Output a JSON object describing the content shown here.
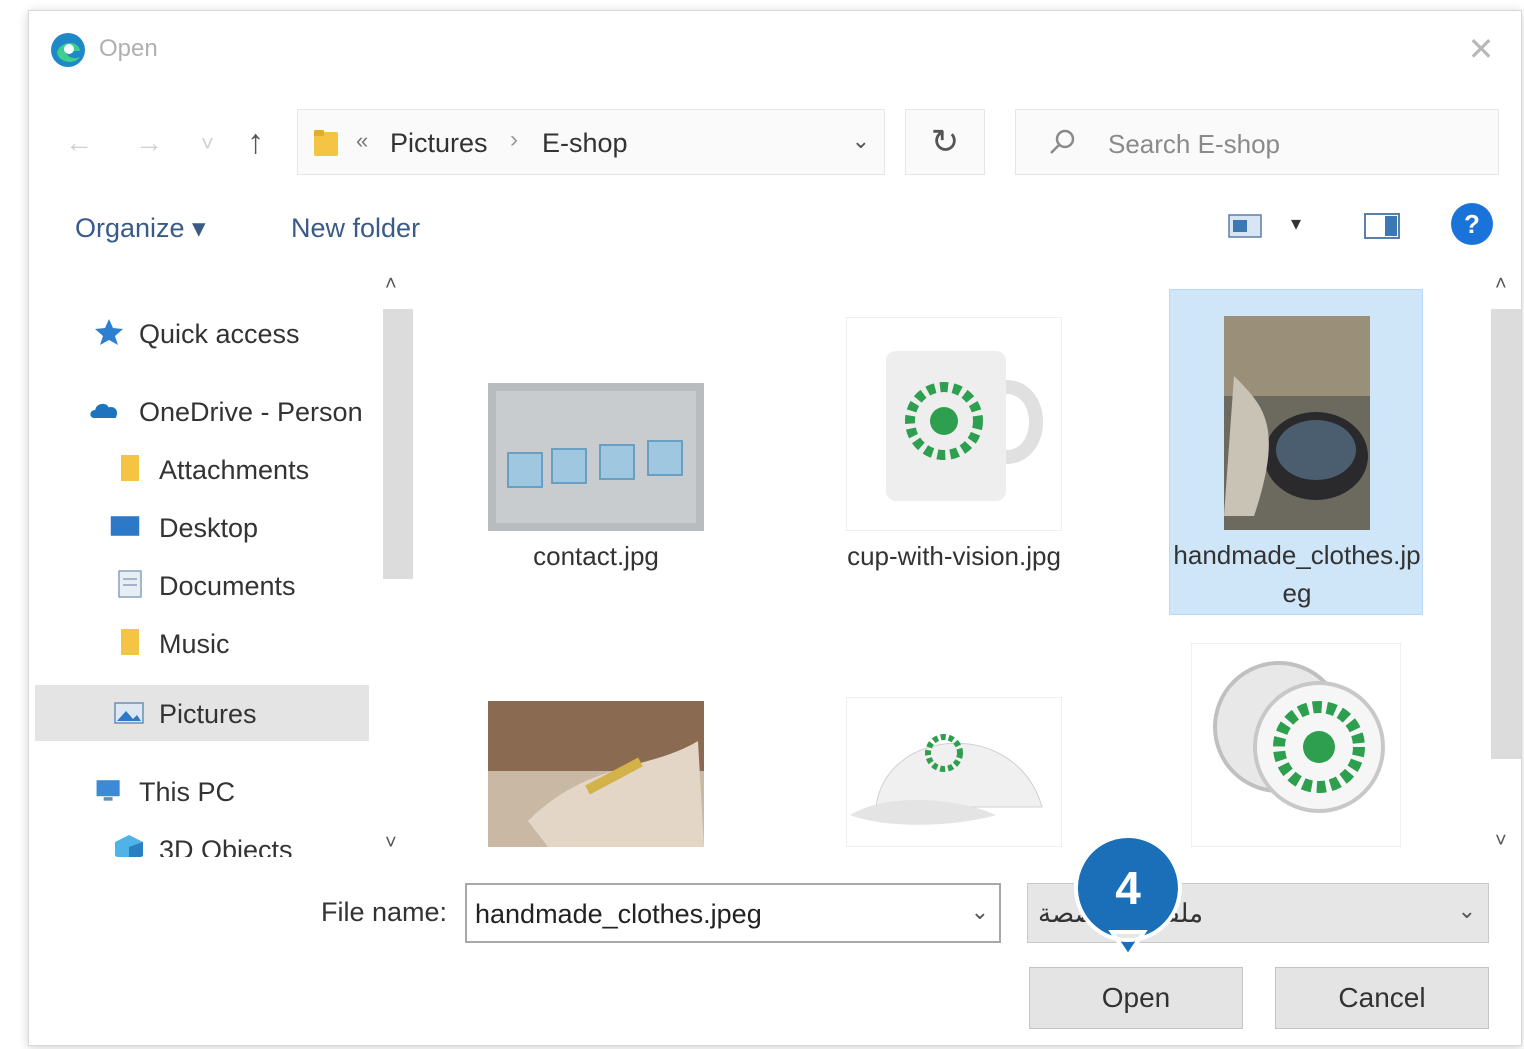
{
  "window": {
    "title": "Open",
    "close_glyph": "✕"
  },
  "nav": {
    "back_glyph": "←",
    "forward_glyph": "→",
    "up_glyph": "↑",
    "recent_glyph": "˅",
    "path_prefix_glyph": "«",
    "breadcrumb": [
      "Pictures",
      "E-shop"
    ],
    "breadcrumb_sep": "›",
    "dropdown_glyph": "⌄",
    "refresh_glyph": "↻",
    "search_placeholder": "Search E-shop"
  },
  "toolbar": {
    "organize_label": "Organize ▾",
    "new_folder_label": "New folder",
    "view_dropdown_glyph": "▾",
    "help_glyph": "?"
  },
  "sidebar": {
    "items": [
      {
        "label": "Quick access",
        "icon": "star-icon"
      },
      {
        "label": "OneDrive - Person",
        "icon": "cloud-icon"
      },
      {
        "label": "Attachments",
        "icon": "folder-icon"
      },
      {
        "label": "Desktop",
        "icon": "desktop-icon"
      },
      {
        "label": "Documents",
        "icon": "documents-icon"
      },
      {
        "label": "Music",
        "icon": "music-folder-icon"
      },
      {
        "label": "Pictures",
        "icon": "pictures-icon",
        "selected": true
      },
      {
        "label": "This PC",
        "icon": "computer-icon"
      },
      {
        "label": "3D Objects",
        "icon": "cube-icon"
      }
    ],
    "scroll_up": "˄",
    "scroll_down": "˅"
  },
  "files": [
    {
      "name": "contact.jpg",
      "thumb": "contact-image"
    },
    {
      "name": "cup-with-vision.jpg",
      "thumb": "mug-image"
    },
    {
      "name": "handmade_clothes.jpeg",
      "thumb": "handmade-image",
      "selected": true
    },
    {
      "name": "",
      "thumb": "sewing-image"
    },
    {
      "name": "",
      "thumb": "cap-image"
    },
    {
      "name": "",
      "thumb": "badge-image"
    }
  ],
  "bottom": {
    "file_name_label": "File name:",
    "file_name_value": "handmade_clothes.jpeg",
    "file_type_value": "ملفات مخصصة",
    "open_label": "Open",
    "cancel_label": "Cancel"
  },
  "callout": {
    "number": "4"
  },
  "colors": {
    "selection": "#cfe5f8",
    "accent": "#1a73d9",
    "callout": "#1a6fb8",
    "logo_green": "#2e9e4f"
  }
}
